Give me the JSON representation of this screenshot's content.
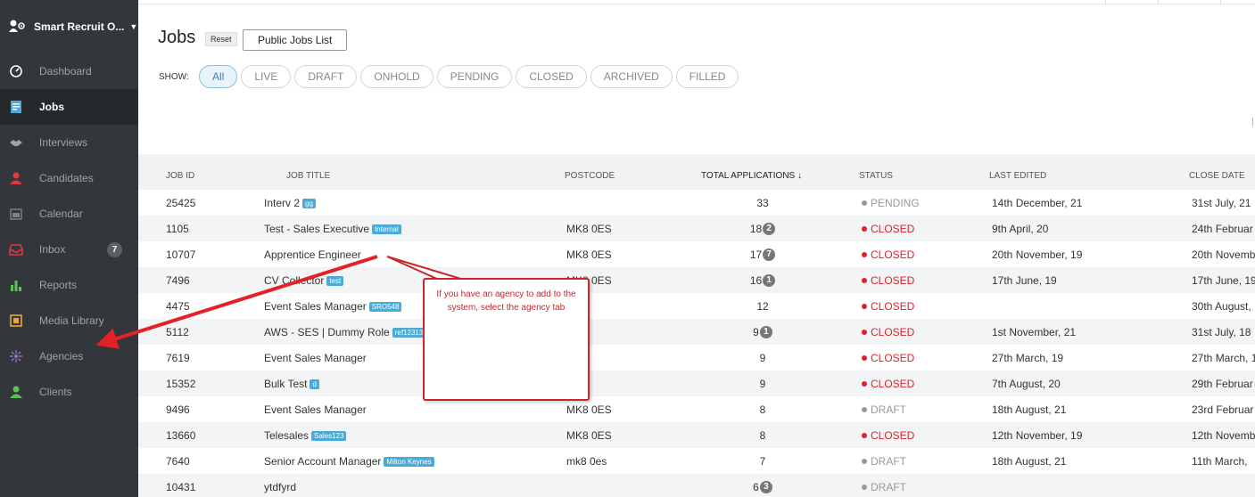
{
  "sidebar": {
    "brand": "Smart Recruit O...",
    "items": [
      {
        "label": "Dashboard",
        "icon": "gauge-icon"
      },
      {
        "label": "Jobs",
        "icon": "jobs-icon",
        "active": true
      },
      {
        "label": "Interviews",
        "icon": "handshake-icon"
      },
      {
        "label": "Candidates",
        "icon": "person-icon"
      },
      {
        "label": "Calendar",
        "icon": "calendar-icon"
      },
      {
        "label": "Inbox",
        "icon": "inbox-icon",
        "badge": "7"
      },
      {
        "label": "Reports",
        "icon": "bar-chart-icon"
      },
      {
        "label": "Media Library",
        "icon": "media-icon"
      },
      {
        "label": "Agencies",
        "icon": "agencies-icon"
      },
      {
        "label": "Clients",
        "icon": "client-icon"
      }
    ]
  },
  "header": {
    "title": "Jobs",
    "reset_label": "Reset",
    "public_label": "Public Jobs List",
    "show_label": "SHOW:",
    "filters": [
      "All",
      "LIVE",
      "DRAFT",
      "ONHOLD",
      "PENDING",
      "CLOSED",
      "ARCHIVED",
      "FILLED"
    ],
    "active_filter": "All"
  },
  "table": {
    "columns": [
      "JOB ID",
      "JOB TITLE",
      "POSTCODE",
      "TOTAL APPLICATIONS ↓",
      "STATUS",
      "LAST EDITED",
      "CLOSE DATE"
    ],
    "rows": [
      {
        "id": "25425",
        "title": "Interv 2",
        "tag": "gg",
        "postcode": "",
        "apps": "33",
        "new": "",
        "status": "PENDING",
        "edited": "14th December, 21",
        "close": "31st July, 21"
      },
      {
        "id": "1105",
        "title": "Test - Sales Executive",
        "tag": "Internal",
        "postcode": "MK8 0ES",
        "apps": "18",
        "new": "2",
        "status": "CLOSED",
        "edited": "9th April, 20",
        "close": "24th Februar"
      },
      {
        "id": "10707",
        "title": "Apprentice Engineer",
        "tag": "",
        "postcode": "MK8 0ES",
        "apps": "17",
        "new": "7",
        "status": "CLOSED",
        "edited": "20th November, 19",
        "close": "20th Novemb"
      },
      {
        "id": "7496",
        "title": "CV Collector",
        "tag": "test",
        "postcode": "MK8 0ES",
        "apps": "16",
        "new": "1",
        "status": "CLOSED",
        "edited": "17th June, 19",
        "close": "17th June, 19"
      },
      {
        "id": "4475",
        "title": "Event Sales Manager",
        "tag": "SRO548",
        "postcode": "0ES",
        "apps": "12",
        "new": "",
        "status": "CLOSED",
        "edited": "",
        "close": "30th August,"
      },
      {
        "id": "5112",
        "title": "AWS - SES | Dummy Role",
        "tag": "ref12313",
        "postcode": "",
        "apps": "9",
        "new": "1",
        "status": "CLOSED",
        "edited": "1st November, 21",
        "close": "31st July, 18"
      },
      {
        "id": "7619",
        "title": "Event Sales Manager",
        "tag": "",
        "postcode": "1QL",
        "apps": "9",
        "new": "",
        "status": "CLOSED",
        "edited": "27th March, 19",
        "close": "27th March, 1"
      },
      {
        "id": "15352",
        "title": "Bulk Test",
        "tag": "d",
        "postcode": "1DP",
        "apps": "9",
        "new": "",
        "status": "CLOSED",
        "edited": "7th August, 20",
        "close": "29th Februar"
      },
      {
        "id": "9496",
        "title": "Event Sales Manager",
        "tag": "",
        "postcode": "MK8 0ES",
        "apps": "8",
        "new": "",
        "status": "DRAFT",
        "edited": "18th August, 21",
        "close": "23rd Februar"
      },
      {
        "id": "13660",
        "title": "Telesales",
        "tag": "Sales123",
        "postcode": "MK8 0ES",
        "apps": "8",
        "new": "",
        "status": "CLOSED",
        "edited": "12th November, 19",
        "close": "12th Novemb"
      },
      {
        "id": "7640",
        "title": "Senior Account Manager",
        "tag": "Milton Keynes",
        "postcode": "mk8 0es",
        "apps": "7",
        "new": "",
        "status": "DRAFT",
        "edited": "18th August, 21",
        "close": "11th March,"
      },
      {
        "id": "10431",
        "title": "ytdfyrd",
        "tag": "",
        "postcode": "",
        "apps": "6",
        "new": "3",
        "status": "DRAFT",
        "edited": "",
        "close": ""
      }
    ]
  },
  "callout": {
    "text": "If you have an agency to add to the system, select the agency tab"
  }
}
